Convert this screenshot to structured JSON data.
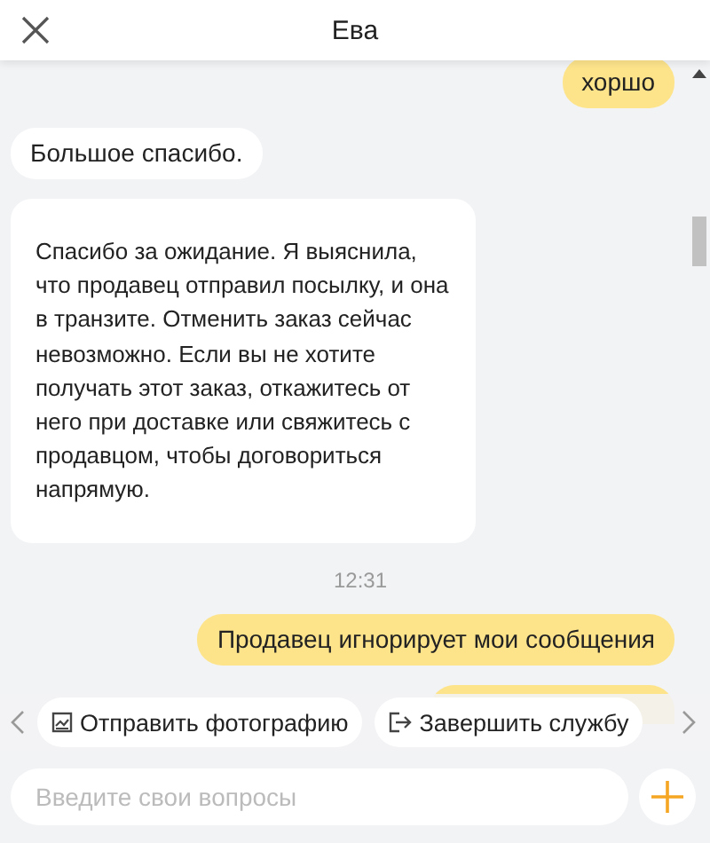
{
  "header": {
    "title": "Ева"
  },
  "messages": [
    {
      "kind": "user",
      "text": "хоршо"
    },
    {
      "kind": "agent",
      "text": "Большое спасибо."
    },
    {
      "kind": "agent",
      "text": "Спасибо за ожидание. Я выяснила, что продавец отправил посылку, и она в транзите. Отменить заказ сейчас невозможно. Если вы не хотите получать этот заказ, откажитесь от него при доставке или свяжитесь с продавцом, чтобы договориться напрямую."
    },
    {
      "kind": "time",
      "text": "12:31"
    },
    {
      "kind": "user",
      "text": "Продавец игнорирует мои сообщения"
    },
    {
      "kind": "covered"
    }
  ],
  "quick_replies": [
    {
      "kind": "photo",
      "label": "Отправить фотографию"
    },
    {
      "kind": "exit",
      "label": "Завершить службу"
    }
  ],
  "input": {
    "placeholder": "Введите свои вопросы"
  }
}
